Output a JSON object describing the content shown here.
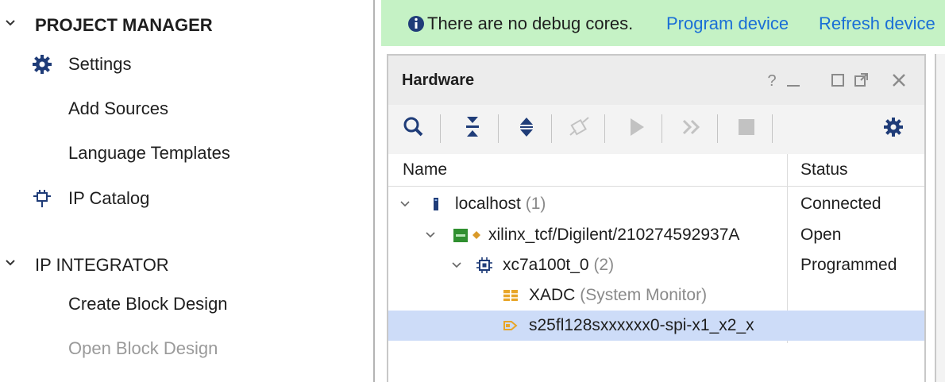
{
  "nav": {
    "project_manager": {
      "label": "PROJECT MANAGER",
      "items": [
        {
          "label": "Settings",
          "icon": "gear-icon"
        },
        {
          "label": "Add Sources"
        },
        {
          "label": "Language Templates"
        },
        {
          "label": "IP Catalog",
          "icon": "ip-catalog-icon"
        }
      ]
    },
    "ip_integrator": {
      "label": "IP INTEGRATOR",
      "items": [
        {
          "label": "Create Block Design"
        },
        {
          "label": "Open Block Design",
          "disabled": true
        }
      ]
    }
  },
  "banner": {
    "message": "There are no debug cores.",
    "program_link": "Program device",
    "refresh_link": "Refresh device",
    "color": "#c5f2c5"
  },
  "hardware": {
    "title": "Hardware",
    "controls": [
      "?",
      "_",
      "□",
      "↗",
      "✕"
    ],
    "columns": {
      "name": "Name",
      "status": "Status"
    },
    "rows": [
      {
        "name": "localhost",
        "count": "(1)",
        "status": "Connected"
      },
      {
        "name": "xilinx_tcf/Digilent/210274592937A",
        "count": "",
        "status": "Open"
      },
      {
        "name": "xc7a100t_0",
        "count": "(2)",
        "status": "Programmed"
      },
      {
        "name": "XADC",
        "count": "(System Monitor)",
        "status": ""
      },
      {
        "name": "s25fl128sxxxxxx0-spi-x1_x2_x",
        "count": "",
        "status": ""
      }
    ]
  },
  "colors": {
    "link": "#1a6fd6",
    "selection": "#cddcf8",
    "banner": "#c5f2c5"
  }
}
